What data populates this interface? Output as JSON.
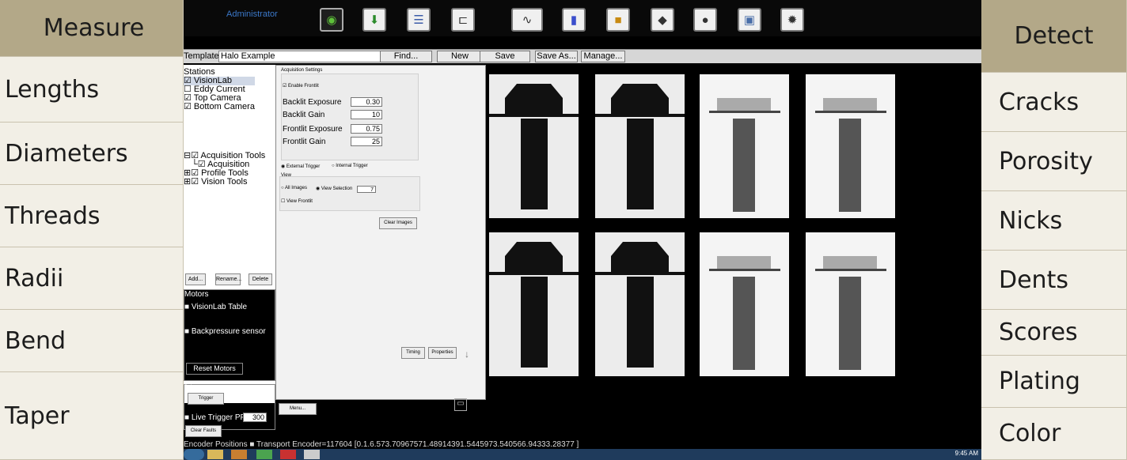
{
  "measure": {
    "title": "Measure",
    "items": [
      "Lengths",
      "Diameters",
      "Threads",
      "Radii",
      "Bend",
      "Taper"
    ]
  },
  "detect": {
    "title": "Detect",
    "items": [
      "Cracks",
      "Porosity",
      "Nicks",
      "Dents",
      "Scores",
      "Plating",
      "Color"
    ]
  },
  "app": {
    "user": "Administrator",
    "toolbar_icons": [
      "camera-icon",
      "graph-icon",
      "report-icon",
      "caliper-icon",
      "waveform-icon",
      "bar-chart-icon",
      "lock-icon",
      "eraser-icon",
      "users-icon",
      "book-icon",
      "settings-icon"
    ],
    "template_label": "Template:",
    "template_value": "Halo Example",
    "buttons": {
      "find": "Find...",
      "new": "New",
      "save": "Save",
      "save_as": "Save As...",
      "manage": "Manage..."
    },
    "stations_title": "Stations",
    "stations": [
      "VisionLab",
      "Eddy Current",
      "Top Camera",
      "Bottom Camera"
    ],
    "tools": [
      "Acquisition Tools",
      "Acquisition",
      "Profile Tools",
      "Vision Tools"
    ],
    "add": "Add...",
    "rename": "Rename...",
    "delete": "Delete",
    "motors_title": "Motors",
    "motors": [
      "VisionLab Table",
      "Backpressure sensor"
    ],
    "reset_motors": "Reset Motors",
    "debug": "Debug",
    "trigger": "Trigger",
    "live_trigger": "Live Trigger",
    "ppm_label": "PPM",
    "ppm_value": "300",
    "clear_faults": "Clear Faults",
    "menu": "Menu...",
    "settings": {
      "title": "Acquisition Settings",
      "enable_frontlit": "Enable Frontlit",
      "backlit_exposure_label": "Backlit Exposure",
      "backlit_exposure": "0.30",
      "backlit_gain_label": "Backlit Gain",
      "backlit_gain": "10",
      "frontlit_exposure_label": "Frontlit Exposure",
      "frontlit_exposure": "0.75",
      "frontlit_gain_label": "Frontlit Gain",
      "frontlit_gain": "25",
      "external_trigger": "External Trigger",
      "internal_trigger": "Internal Trigger",
      "view": "View",
      "all_images": "All Images",
      "view_selection": "View Selection",
      "view_frontlit": "View Frontlit",
      "clear_images": "Clear Images",
      "timing": "Timing",
      "properties": "Properties"
    },
    "status": "Encoder Positions    ■ Transport   Encoder=117604   [0.1.6.573.70967571.48914391.5445973.540566.94333.28377 ]",
    "clock": "9:45 AM"
  }
}
